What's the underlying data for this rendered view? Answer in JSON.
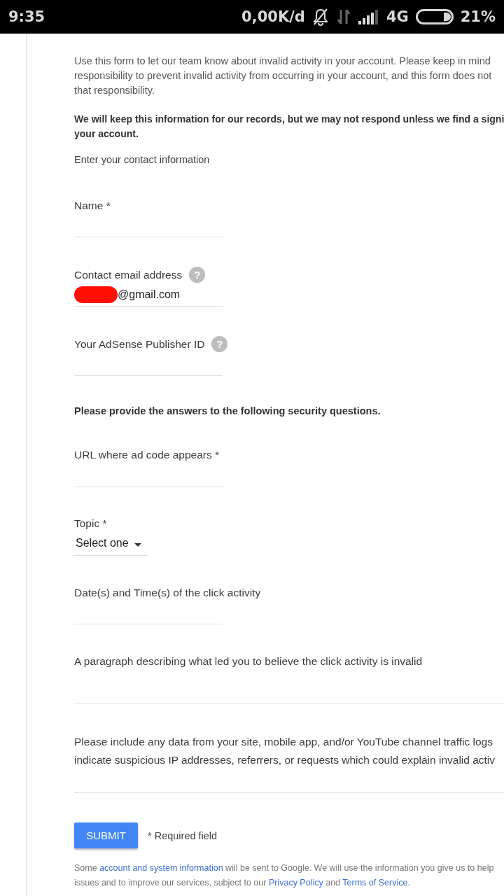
{
  "status_bar": {
    "time": "9:35",
    "speed": "0,00K/d",
    "network": "4G",
    "battery": "21%"
  },
  "intro": [
    "Use this form to let our team know about invalid activity in your account. Please keep in mind",
    "responsibility to prevent invalid activity from occurring in your account, and this form does not",
    "that responsibility."
  ],
  "notice": [
    "We will keep this information for our records, but we may not respond unless we find a signi",
    "your account."
  ],
  "contact_heading": "Enter your contact information",
  "fields": [
    {
      "kind": "text",
      "label": "Name *"
    },
    {
      "kind": "text",
      "label": "Contact email address",
      "help": "?",
      "value": "@gmail.com",
      "redacted": true
    },
    {
      "kind": "text",
      "label": "Your AdSense Publisher ID",
      "help": "?"
    },
    {
      "kind": "heading",
      "label": "Please provide the answers to the following security questions."
    },
    {
      "kind": "text",
      "label": "URL where ad code appears *"
    },
    {
      "kind": "select",
      "label": "Topic *",
      "value": "Select one"
    },
    {
      "kind": "text",
      "label": "Date(s) and Time(s) of the click activity"
    },
    {
      "kind": "textarea",
      "label": "A paragraph describing what led you to believe the click activity is invalid"
    },
    {
      "kind": "textarea",
      "label": "Please include any data from your site, mobile app, and/or YouTube channel traffic logs\nindicate suspicious IP addresses, referrers, or requests which could explain invalid activ"
    }
  ],
  "submit": "SUBMIT",
  "required_note": "* Required field",
  "footer": [
    [
      {
        "kind": "text",
        "text": "Some "
      },
      {
        "kind": "link",
        "text": "account and system information"
      },
      {
        "kind": "text",
        "text": " will be sent to Google. We will use the information you give us to help"
      }
    ],
    [
      {
        "kind": "text",
        "text": "issues and to improve our services, subject to our "
      },
      {
        "kind": "link",
        "text": "Privacy Policy"
      },
      {
        "kind": "text",
        "text": " and "
      },
      {
        "kind": "link",
        "text": "Terms of Service"
      },
      {
        "kind": "text",
        "text": "."
      }
    ]
  ]
}
